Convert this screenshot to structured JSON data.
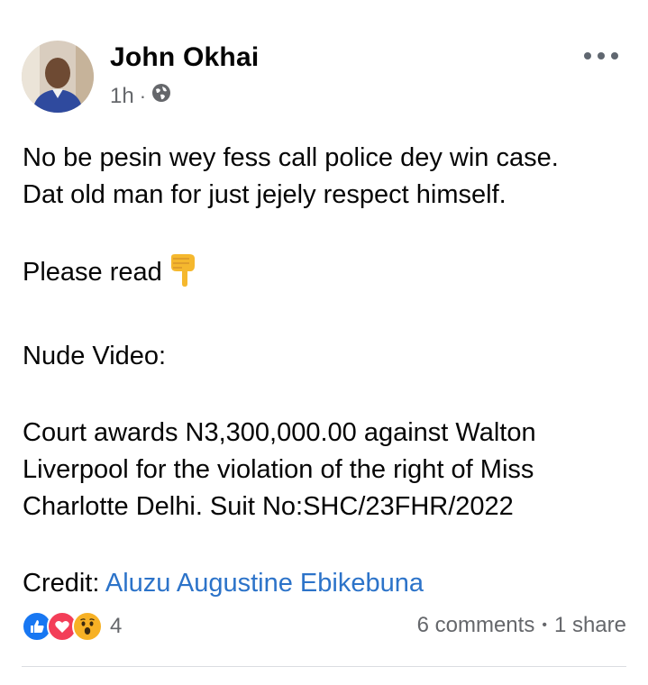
{
  "post": {
    "author": "John Okhai",
    "time": "1h",
    "separator": "·",
    "privacy_icon": "globe-icon",
    "paragraphs": {
      "line1": "No be pesin wey fess call police dey win case.",
      "line2": "Dat old man for just jejely respect himself.",
      "please_read": "Please read",
      "please_read_emoji": "backhand-index-pointing-down",
      "nude_video": "Nude Video:",
      "court1": "Court awards N3,300,000.00 against Walton",
      "court2": "Liverpool for the violation of the right of Miss",
      "court3": "Charlotte Delhi. Suit No:SHC/23FHR/2022",
      "credit_label": "Credit:",
      "credit_link": "Aluzu Augustine Ebikebuna"
    }
  },
  "footer": {
    "reactions": [
      "like-icon",
      "love-icon",
      "wow-icon"
    ],
    "reaction_count": "4",
    "comments": "6 comments",
    "dot": "•",
    "shares": "1 share"
  },
  "colors": {
    "link": "#2c73c9",
    "like": "#1877f2",
    "love": "#f33e58",
    "wow": "#f7b125",
    "muted": "#65676b"
  }
}
